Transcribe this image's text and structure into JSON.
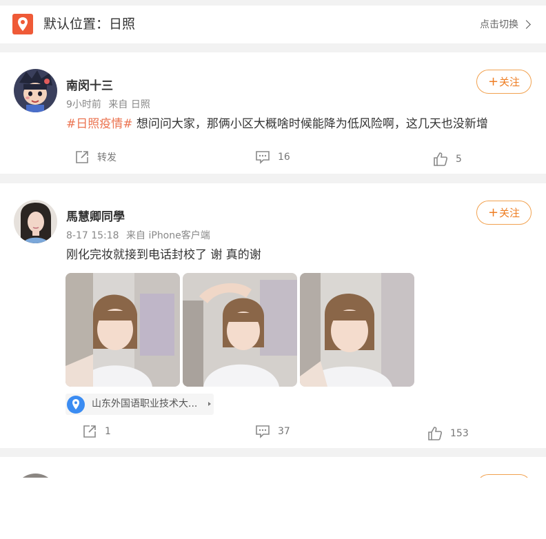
{
  "location_bar": {
    "title": "默认位置：日照",
    "switch_label": "点击切换"
  },
  "posts": [
    {
      "username": "南闵十三",
      "time": "9小时前",
      "source": "来自 日照",
      "hashtag": "#日照疫情#",
      "text": " 想问问大家，那俩小区大概啥时候能降为低风险啊，这几天也没新增",
      "follow_label": "关注",
      "actions": {
        "repost": "转发",
        "comments": "16",
        "likes": "5"
      }
    },
    {
      "username": "馬慧卿同學",
      "time": "8-17 15:18",
      "source": "来自 iPhone客户端",
      "text": "刚化完妆就接到电话封校了 谢 真的谢",
      "follow_label": "关注",
      "location_tag": "山东外国语职业技术大...",
      "images": [
        "selfie-photo-1",
        "selfie-photo-2",
        "selfie-photo-3"
      ],
      "actions": {
        "repost": "1",
        "comments": "37",
        "likes": "153"
      }
    }
  ],
  "colors": {
    "accent_orange": "#ee7d22",
    "hashtag": "#eb7350",
    "location_icon_bg": "#ef5a37",
    "place_pin": "#3b8cf2"
  }
}
